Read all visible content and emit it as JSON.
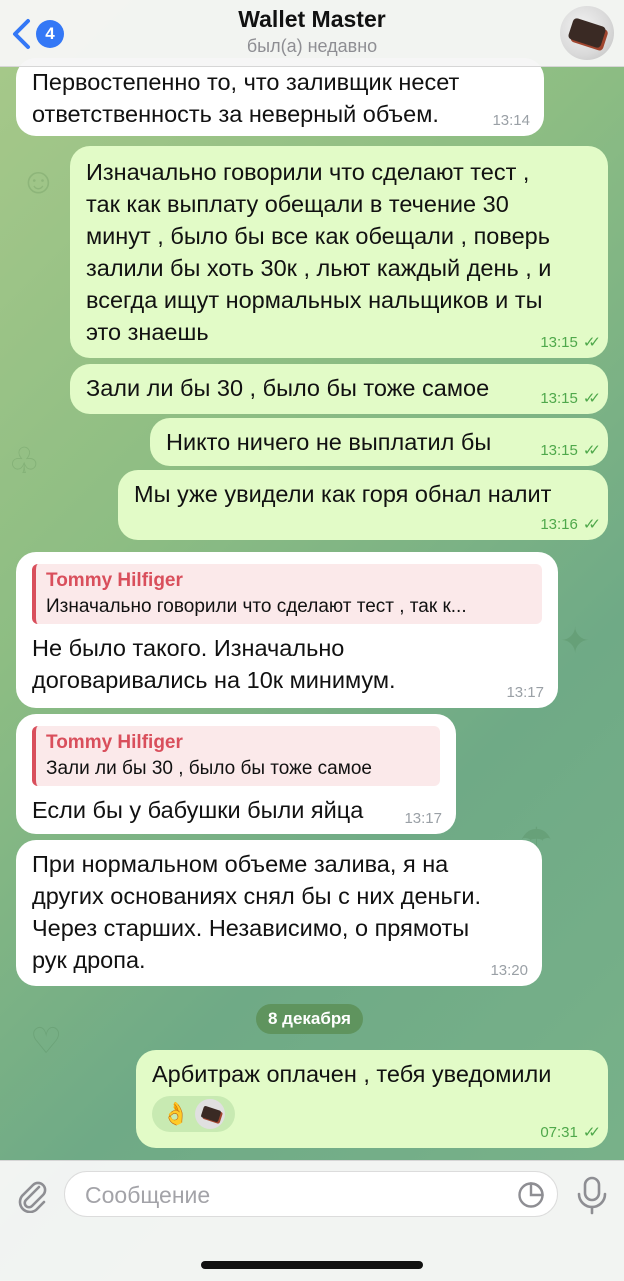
{
  "header": {
    "back_count": "4",
    "title": "Wallet Master",
    "status": "был(а) недавно"
  },
  "messages": [
    {
      "text": "Первостепенно то, что заливщик несет\nответственность за неверный объем.",
      "time": "13:14"
    },
    {
      "text": "Изначально говорили что сделают тест ,\nтак как выплату обещали в течение 30\nминут , было бы все как обещали , поверь\nзалили бы хоть 30к , льют каждый день , и\nвсегда ищут нормальных нальщиков и ты\nэто знаешь",
      "time": "13:15"
    },
    {
      "text": "Зали ли бы 30 , было бы тоже самое",
      "time": "13:15"
    },
    {
      "text": "Никто ничего не выплатил бы",
      "time": "13:15"
    },
    {
      "text": "Мы уже увидели как горя обнал налит",
      "time": "13:16"
    },
    {
      "reply_author": "Tommy Hilfiger",
      "reply_text": "Изначально говорили что сделают тест , так к...",
      "text": "Не было такого. Изначально\nдоговаривались на 10к минимум.",
      "time": "13:17"
    },
    {
      "reply_author": "Tommy Hilfiger",
      "reply_text": "Зали ли бы 30 , было бы тоже самое",
      "text": "Если бы у бабушки были яйца",
      "time": "13:17"
    },
    {
      "text": "При нормальном объеме залива, я на\nдругих основаниях снял бы с них деньги.\nЧерез старших. Независимо, о прямоты\nрук дропа.",
      "time": "13:20"
    },
    {
      "text": "Арбитраж оплачен , тебя уведомили",
      "time": "07:31",
      "reaction": "👌"
    }
  ],
  "date_separator": "8 декабря",
  "composer": {
    "placeholder": "Сообщение"
  },
  "colors": {
    "accent": "#3478f6",
    "outgoing_bubble": "#e2fbc7",
    "incoming_bubble": "#ffffff",
    "reply_name": "#d94f5c",
    "read_check": "#4fa84b"
  },
  "icons": [
    "back-chevron-icon",
    "paperclip-icon",
    "sticker-icon",
    "microphone-icon",
    "double-check-icon"
  ]
}
